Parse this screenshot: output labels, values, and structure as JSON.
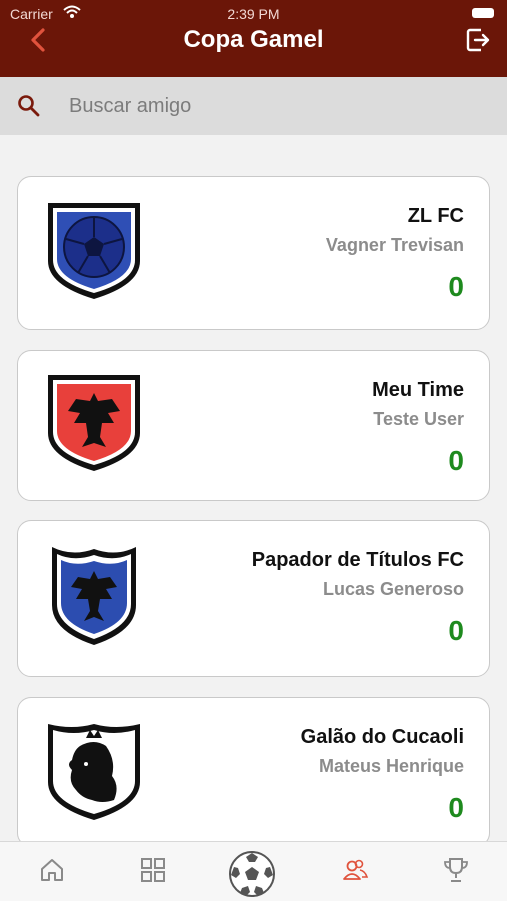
{
  "status_bar": {
    "carrier": "Carrier",
    "time": "2:39 PM"
  },
  "header": {
    "title": "Copa Gamel"
  },
  "search": {
    "placeholder": "Buscar amigo",
    "value": ""
  },
  "teams": [
    {
      "name": "ZL FC",
      "owner": "Vagner Trevisan",
      "score": "0",
      "crest": "blue-soccer-ball-crest"
    },
    {
      "name": "Meu Time",
      "owner": "Teste User",
      "score": "0",
      "crest": "red-eagle-crest"
    },
    {
      "name": "Papador de Títulos FC",
      "owner": "Lucas Generoso",
      "score": "0",
      "crest": "blue-eagle-crest"
    },
    {
      "name": "Galão do Cucaoli",
      "owner": "Mateus Henrique",
      "score": "0",
      "crest": "white-lion-crest"
    }
  ],
  "tabbar": {
    "tabs": [
      "home-icon",
      "grid-icon",
      "soccer-ball-icon",
      "friends-icon",
      "trophy-icon"
    ],
    "active": "friends-icon"
  },
  "colors": {
    "header": "#6b1608",
    "accent": "#e0533d",
    "score": "#1e8a1e"
  }
}
